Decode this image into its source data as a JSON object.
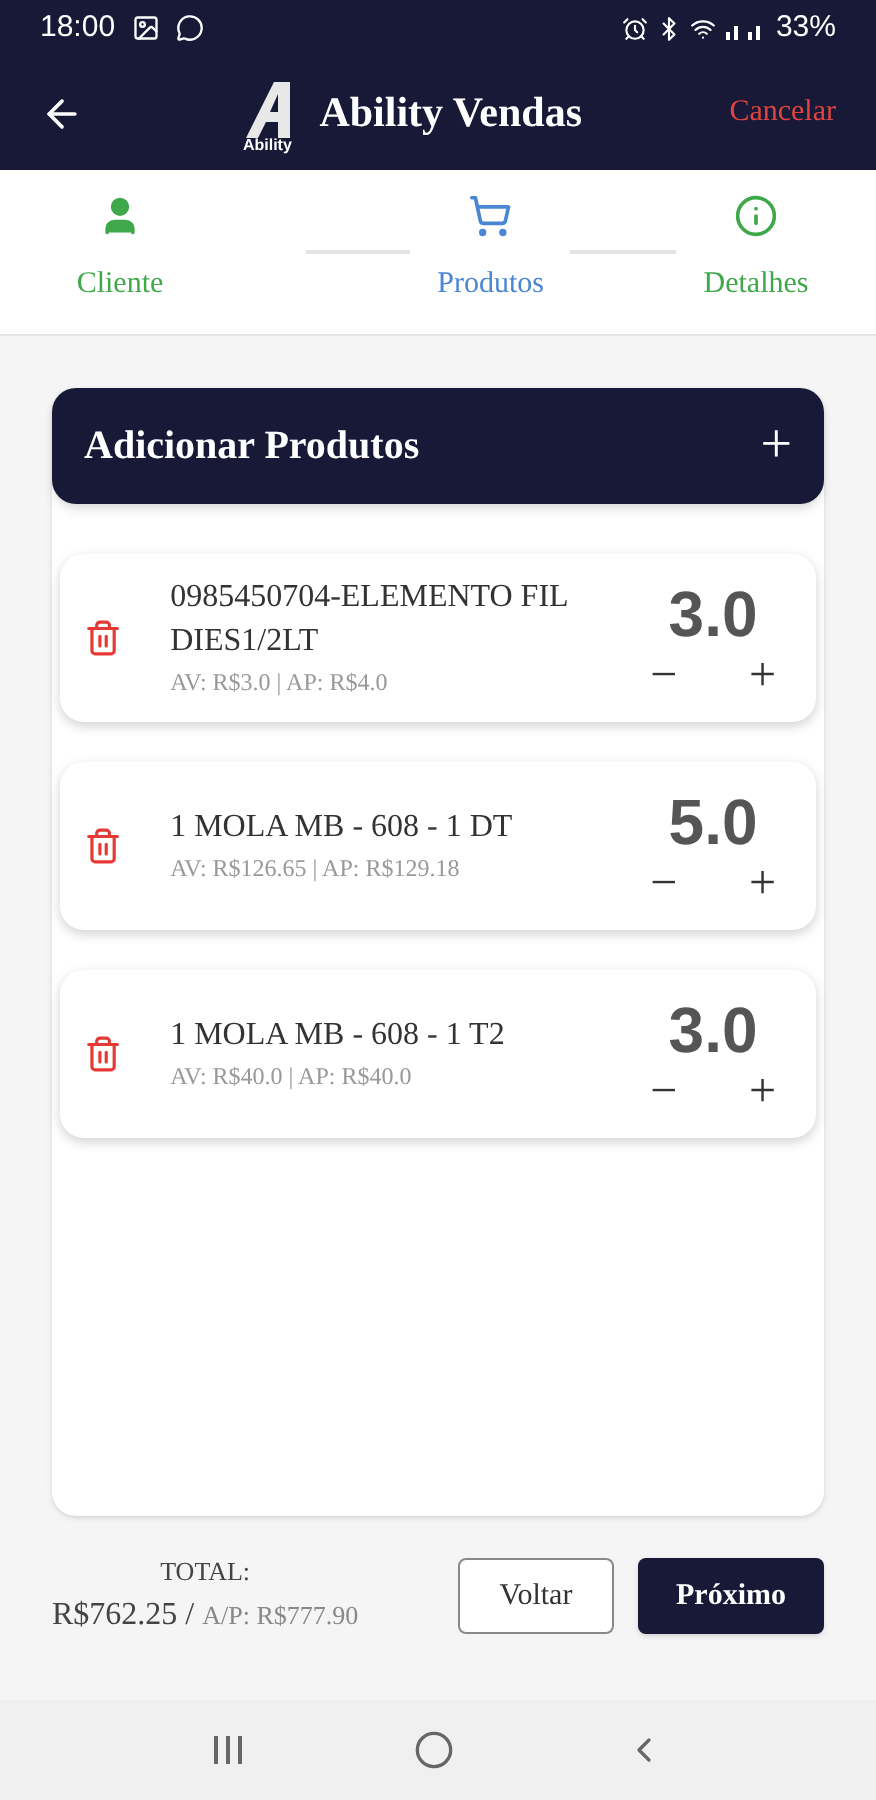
{
  "status_bar": {
    "time": "18:00",
    "battery": "33%"
  },
  "header": {
    "title": "Ability Vendas",
    "logo_text": "Ability",
    "cancel": "Cancelar"
  },
  "steps": [
    {
      "label": "Cliente",
      "kind": "person",
      "selected": false
    },
    {
      "label": "Produtos",
      "kind": "cart",
      "selected": true
    },
    {
      "label": "Detalhes",
      "kind": "info",
      "selected": false
    }
  ],
  "panel": {
    "title": "Adicionar Produtos",
    "add": "+"
  },
  "items": [
    {
      "name": "0985450704-ELEMENTO FIL DIES1/2LT",
      "prices": "AV: R$3.0 | AP: R$4.0",
      "quantity": "3.0",
      "minus": "−",
      "plus": "+"
    },
    {
      "name": "1 MOLA MB - 608 - 1 DT",
      "prices": "AV: R$126.65 | AP: R$129.18",
      "quantity": "5.0",
      "minus": "−",
      "plus": "+"
    },
    {
      "name": "1 MOLA MB - 608 - 1 T2",
      "prices": "AV: R$40.0 | AP: R$40.0",
      "quantity": "3.0",
      "minus": "−",
      "plus": "+"
    }
  ],
  "footer": {
    "total_label": "TOTAL:",
    "total": "R$762.25 /",
    "ap_total": "A/P: R$777.90",
    "back": "Voltar",
    "next": "Próximo"
  }
}
